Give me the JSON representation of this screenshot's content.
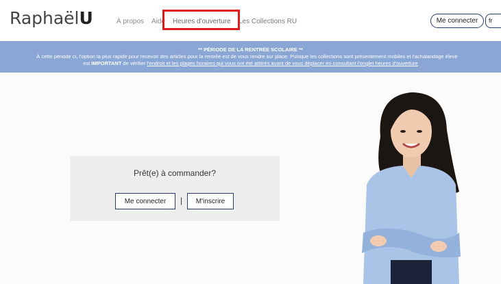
{
  "header": {
    "logo_text": "Raphaël",
    "logo_bold": "U",
    "nav": {
      "apropos": "À propos",
      "aide": "Aide",
      "heures": "Heures d'ouverture",
      "collections": "Les Collections RU"
    },
    "login_label": "Me connecter",
    "lang_value": "fr"
  },
  "banner": {
    "title": "** PÉRIODE DE LA RENTRÉE SCOLAIRE **",
    "line2": "À cette période ci, l'option la plus rapide pour recevoir des articles pour la rentrée est de vous rendre sur place. Puisque les collections sont présentement mobiles et l'achalandage élevé",
    "line3_prefix": "est ",
    "line3_important": "IMPORTANT",
    "line3_middle": " de vérifier ",
    "line3_link": "l'endroit et les plages horaires qui vous ont été attitrés avant de vous déplacer en consultant l'onglet heures d'ouverture"
  },
  "hero": {
    "prompt": "Prêt(e) à commander?",
    "login_button": "Me connecter",
    "separator": "|",
    "signup_button": "M'inscrire"
  },
  "colors": {
    "banner_bg": "#8aa6d4",
    "highlight": "#e01b1b",
    "button_border": "#2a3a6a"
  }
}
